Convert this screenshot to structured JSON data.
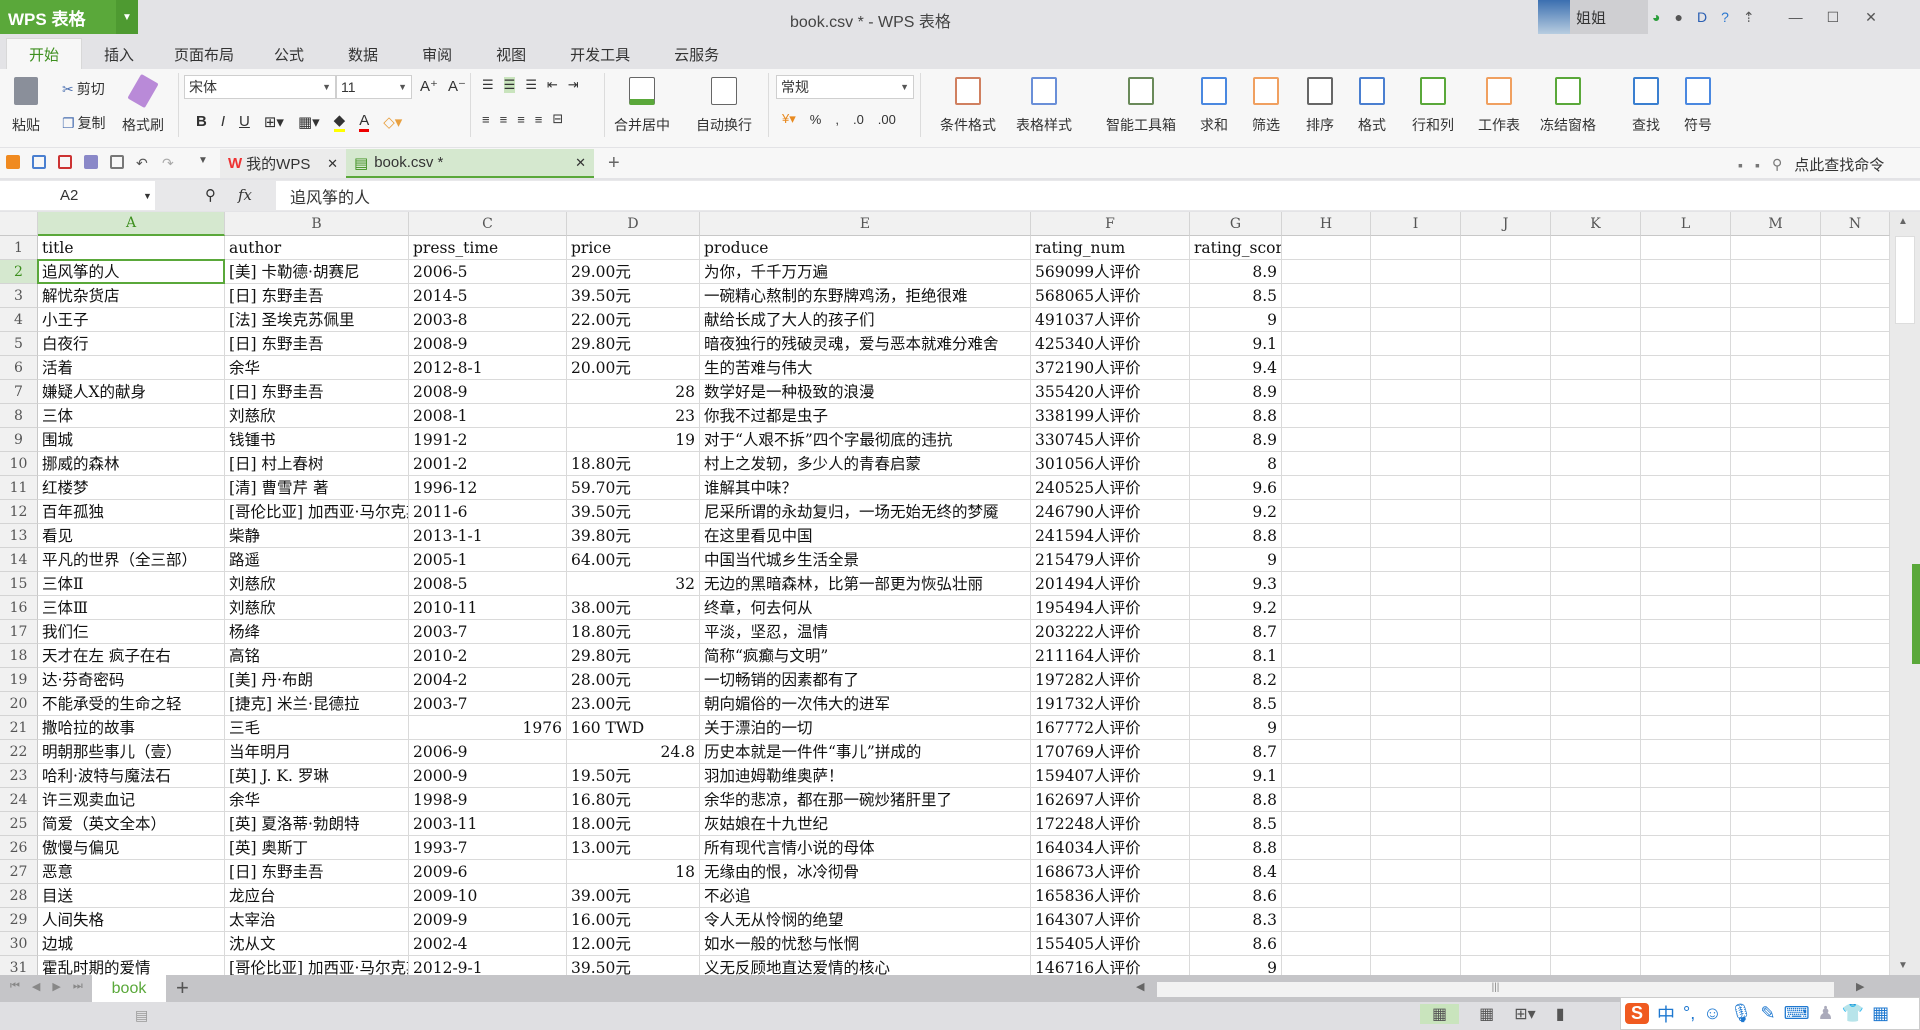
{
  "app": {
    "name": "WPS 表格",
    "window_title": "book.csv * - WPS 表格",
    "user": "姐姐",
    "accent": "#5aa83a"
  },
  "menu_tabs": [
    "开始",
    "插入",
    "页面布局",
    "公式",
    "数据",
    "审阅",
    "视图",
    "开发工具",
    "云服务"
  ],
  "ribbon": {
    "paste": "粘贴",
    "cut": "剪切",
    "copy": "复制",
    "format_painter": "格式刷",
    "font_name": "宋体",
    "font_size": "11",
    "merge_center": "合并居中",
    "wrap_text": "自动换行",
    "number_format": "常规",
    "big_buttons": [
      "条件格式",
      "表格样式",
      "智能工具箱",
      "求和",
      "筛选",
      "排序",
      "格式",
      "行和列",
      "工作表",
      "冻结窗格",
      "查找",
      "符号"
    ]
  },
  "doc_tabs": [
    {
      "label": "我的WPS"
    },
    {
      "label": "book.csv *",
      "active": true
    }
  ],
  "search_command": "点此查找命令",
  "formula_bar": {
    "name_box": "A2",
    "fx": "fx",
    "value": "追风筝的人"
  },
  "columns": [
    "A",
    "B",
    "C",
    "D",
    "E",
    "F",
    "G",
    "H",
    "I",
    "J",
    "K",
    "L",
    "M",
    "N"
  ],
  "selected_cell": "A2",
  "rows": [
    [
      "title",
      "author",
      "press_time",
      "price",
      "produce",
      "rating_num",
      "rating_score"
    ],
    [
      "追风筝的人",
      "[美] 卡勒德·胡赛尼",
      "2006-5",
      "29.00元",
      "为你，千千万万遍",
      "569099人评价",
      "8.9"
    ],
    [
      "解忧杂货店",
      "[日] 东野圭吾",
      "2014-5",
      "39.50元",
      "一碗精心熬制的东野牌鸡汤，拒绝很难",
      "568065人评价",
      "8.5"
    ],
    [
      "小王子",
      "[法] 圣埃克苏佩里",
      "2003-8",
      "22.00元",
      "献给长成了大人的孩子们",
      "491037人评价",
      "9"
    ],
    [
      "白夜行",
      "[日] 东野圭吾",
      "2008-9",
      "29.80元",
      "暗夜独行的残破灵魂，爱与恶本就难分难舍",
      "425340人评价",
      "9.1"
    ],
    [
      "活着",
      "余华",
      "2012-8-1",
      "20.00元",
      "生的苦难与伟大",
      "372190人评价",
      "9.4"
    ],
    [
      "嫌疑人X的献身",
      "[日] 东野圭吾",
      "2008-9",
      "28",
      "数学好是一种极致的浪漫",
      "355420人评价",
      "8.9"
    ],
    [
      "三体",
      "刘慈欣",
      "2008-1",
      "23",
      "你我不过都是虫子",
      "338199人评价",
      "8.8"
    ],
    [
      "围城",
      "钱锺书",
      "1991-2",
      "19",
      "对于“人艰不拆”四个字最彻底的违抗",
      "330745人评价",
      "8.9"
    ],
    [
      "挪威的森林",
      "[日] 村上春树",
      "2001-2",
      "18.80元",
      "村上之发轫，多少人的青春启蒙",
      "301056人评价",
      "8"
    ],
    [
      "红楼梦",
      "[清] 曹雪芹 著",
      "1996-12",
      "59.70元",
      "谁解其中味？",
      "240525人评价",
      "9.6"
    ],
    [
      "百年孤独",
      "[哥伦比亚] 加西亚·马尔克斯",
      "2011-6",
      "39.50元",
      "尼采所谓的永劫复归，一场无始无终的梦魇",
      "246790人评价",
      "9.2"
    ],
    [
      "看见",
      "柴静",
      "2013-1-1",
      "39.80元",
      "在这里看见中国",
      "241594人评价",
      "8.8"
    ],
    [
      "平凡的世界（全三部）",
      "路遥",
      "2005-1",
      "64.00元",
      "中国当代城乡生活全景",
      "215479人评价",
      "9"
    ],
    [
      "三体Ⅱ",
      "刘慈欣",
      "2008-5",
      "32",
      "无边的黑暗森林，比第一部更为恢弘壮丽",
      "201494人评价",
      "9.3"
    ],
    [
      "三体Ⅲ",
      "刘慈欣",
      "2010-11",
      "38.00元",
      "终章，何去何从",
      "195494人评价",
      "9.2"
    ],
    [
      "我们仨",
      "杨绛",
      "2003-7",
      "18.80元",
      "平淡，坚忍，温情",
      "203222人评价",
      "8.7"
    ],
    [
      "天才在左 疯子在右",
      "高铭",
      "2010-2",
      "29.80元",
      "简称“疯癫与文明”",
      "211164人评价",
      "8.1"
    ],
    [
      "达·芬奇密码",
      "[美] 丹·布朗",
      "2004-2",
      "28.00元",
      "一切畅销的因素都有了",
      "197282人评价",
      "8.2"
    ],
    [
      "不能承受的生命之轻",
      "[捷克] 米兰·昆德拉",
      "2003-7",
      "23.00元",
      "朝向媚俗的一次伟大的进军",
      "191732人评价",
      "8.5"
    ],
    [
      "撒哈拉的故事",
      "三毛",
      "1976",
      "160 TWD",
      "关于漂泊的一切",
      "167772人评价",
      "9"
    ],
    [
      "明朝那些事儿（壹）",
      "当年明月",
      "2006-9",
      "24.8",
      "历史本就是一件件“事儿”拼成的",
      "170769人评价",
      "8.7"
    ],
    [
      "哈利·波特与魔法石",
      "[英] J. K. 罗琳",
      "2000-9",
      "19.50元",
      "羽加迪姆勒维奥萨！",
      "159407人评价",
      "9.1"
    ],
    [
      "许三观卖血记",
      "余华",
      "1998-9",
      "16.80元",
      "余华的悲凉，都在那一碗炒猪肝里了",
      "162697人评价",
      "8.8"
    ],
    [
      "简爱（英文全本）",
      "[英] 夏洛蒂·勃朗特",
      "2003-11",
      "18.00元",
      "灰姑娘在十九世纪",
      "172248人评价",
      "8.5"
    ],
    [
      "傲慢与偏见",
      "[英] 奥斯丁",
      "1993-7",
      "13.00元",
      "所有现代言情小说的母体",
      "164034人评价",
      "8.8"
    ],
    [
      "恶意",
      "[日] 东野圭吾",
      "2009-6",
      "18",
      "无缘由的恨，冰冷彻骨",
      "168673人评价",
      "8.4"
    ],
    [
      "目送",
      "龙应台",
      "2009-10",
      "39.00元",
      "不必追",
      "165836人评价",
      "8.6"
    ],
    [
      "人间失格",
      "太宰治",
      "2009-9",
      "16.00元",
      "令人无从怜悯的绝望",
      "164307人评价",
      "8.3"
    ],
    [
      "边城",
      "沈从文",
      "2002-4",
      "12.00元",
      "如水一般的忧愁与怅惘",
      "155405人评价",
      "8.6"
    ],
    [
      "霍乱时期的爱情",
      "[哥伦比亚] 加西亚·马尔克斯",
      "2012-9-1",
      "39.50元",
      "义无反顾地直达爱情的核心",
      "146716人评价",
      "9"
    ]
  ],
  "sheet_tabs": [
    "book"
  ],
  "ime": {
    "logo": "S",
    "mode": "中",
    "punct": "°,"
  }
}
